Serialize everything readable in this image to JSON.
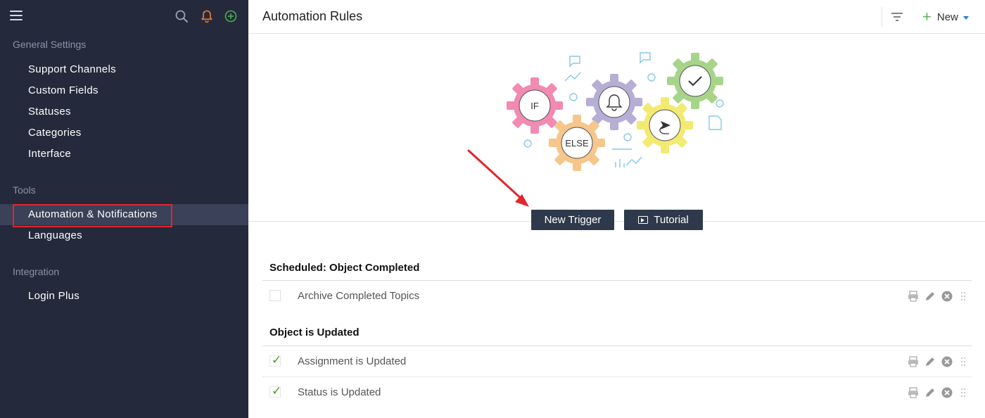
{
  "sidebar": {
    "sections": [
      {
        "title": "General Settings",
        "items": [
          "Support Channels",
          "Custom Fields",
          "Statuses",
          "Categories",
          "Interface"
        ]
      },
      {
        "title": "Tools",
        "items": [
          "Automation & Notifications",
          "Languages"
        ]
      },
      {
        "title": "Integration",
        "items": [
          "Login Plus"
        ]
      }
    ],
    "active_item": "Automation & Notifications",
    "icons": [
      "hamburger-menu-icon",
      "search-icon",
      "bell-icon",
      "add-circle-icon"
    ],
    "colors": {
      "background": "#242a3b",
      "active": "#3a4158",
      "bell": "#e0762d",
      "add": "#4caf50",
      "highlight": "#e0262d"
    }
  },
  "header": {
    "title": "Automation Rules",
    "new_label": "New",
    "icons": [
      "filter-icon",
      "plus-icon",
      "caret-down-icon"
    ]
  },
  "illustration": {
    "if_label": "IF",
    "else_label": "ELSE"
  },
  "actions": {
    "new_trigger_label": "New Trigger",
    "tutorial_label": "Tutorial"
  },
  "rule_groups": [
    {
      "title": "Scheduled: Object Completed",
      "rules": [
        {
          "label": "Archive Completed Topics",
          "enabled": false
        }
      ]
    },
    {
      "title": "Object is Updated",
      "rules": [
        {
          "label": "Assignment is Updated",
          "enabled": true
        },
        {
          "label": "Status is Updated",
          "enabled": true
        }
      ]
    }
  ],
  "check_mark": "✓",
  "row_action_icons": [
    "print-icon",
    "edit-pencil-icon",
    "delete-circle-icon",
    "drag-handle-icon"
  ]
}
